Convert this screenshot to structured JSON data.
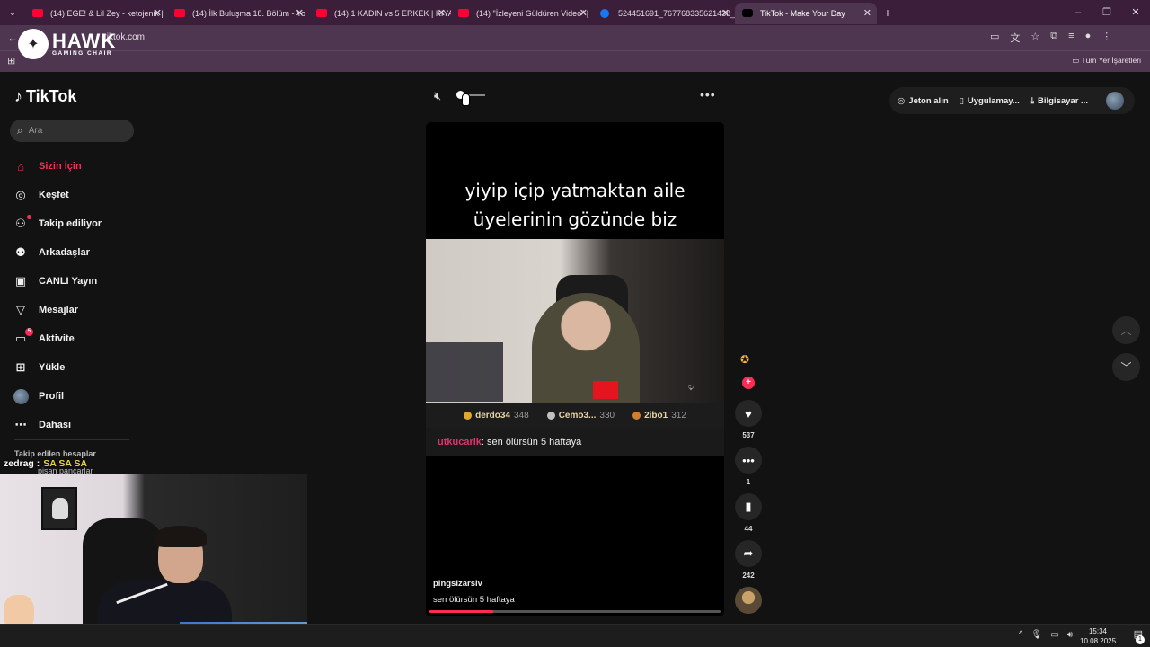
{
  "browser": {
    "tabs": [
      {
        "title": "(14) EGE! & Lil Zey - ketojenik |",
        "icon": "youtube-icon"
      },
      {
        "title": "(14) İlk Buluşma 18. Bölüm - Yo",
        "icon": "youtube-icon"
      },
      {
        "title": "(14) 1 KADIN vs 5 ERKEK | KIYA",
        "icon": "youtube-icon"
      },
      {
        "title": "(14) \"İzleyeni Güldüren Video\" |",
        "icon": "youtube-icon"
      },
      {
        "title": "524451691_767768335621438_",
        "icon": "facebook-icon"
      },
      {
        "title": "TikTok - Make Your Day",
        "icon": "tiktok-icon"
      }
    ],
    "new_tab": "+",
    "address": "tiktok.com",
    "bookmarks_all": "Tüm Yer İşaretleri",
    "window_controls": [
      "–",
      "❐",
      "✕"
    ]
  },
  "overlay_brand": {
    "name": "HAWK",
    "sub": "GAMING CHAIR"
  },
  "tiktok": {
    "logo": "TikTok",
    "search_placeholder": "Ara",
    "nav": [
      {
        "label": "Sizin İçin",
        "icon": "home-icon",
        "glyph": "⌂",
        "active": true
      },
      {
        "label": "Keşfet",
        "icon": "compass-icon",
        "glyph": "◎"
      },
      {
        "label": "Takip ediliyor",
        "icon": "following-icon",
        "glyph": "⚇"
      },
      {
        "label": "Arkadaşlar",
        "icon": "friends-icon",
        "glyph": "⚉"
      },
      {
        "label": "CANLI Yayın",
        "icon": "live-icon",
        "glyph": "▣"
      },
      {
        "label": "Mesajlar",
        "icon": "messages-icon",
        "glyph": "▽"
      },
      {
        "label": "Aktivite",
        "icon": "activity-icon",
        "glyph": "▭",
        "badge": "5"
      },
      {
        "label": "Yükle",
        "icon": "upload-icon",
        "glyph": "⊞"
      },
      {
        "label": "Profil",
        "icon": "profile-icon",
        "glyph": ""
      },
      {
        "label": "Dahası",
        "icon": "more-icon",
        "glyph": "⋯"
      }
    ],
    "followed_accounts": "Takip edilen hesaplar",
    "followed_partial": "pisan pancarlar",
    "top_right": {
      "coins": "Jeton alın",
      "app": "Uygulamay...",
      "desktop": "Bilgisayar ..."
    },
    "video": {
      "caption_line1": "yiyip içip yatmaktan aile",
      "caption_line2": "üyelerinin gözünde biz",
      "ranks": [
        {
          "name": "derdo34",
          "score": "348",
          "color": "#e0a82e"
        },
        {
          "name": "Cemo3...",
          "score": "330",
          "color": "#c0c0c0"
        },
        {
          "name": "2ibo1",
          "score": "312",
          "color": "#cd7f32"
        }
      ],
      "comment_user": "utkucarik",
      "comment_text": ": sen ölürsün 5 haftaya",
      "author": "pingsizarsiv",
      "description": "sen ölürsün 5 haftaya",
      "progress": 0.22
    },
    "actions": {
      "likes": "537",
      "comments": "1",
      "saves": "44",
      "shares": "242"
    }
  },
  "stream_chat": {
    "user": "zedrag :",
    "message": "SA SA SA"
  },
  "taskbar": {
    "time": "15:34",
    "date": "10.08.2025",
    "notifications": "1"
  }
}
